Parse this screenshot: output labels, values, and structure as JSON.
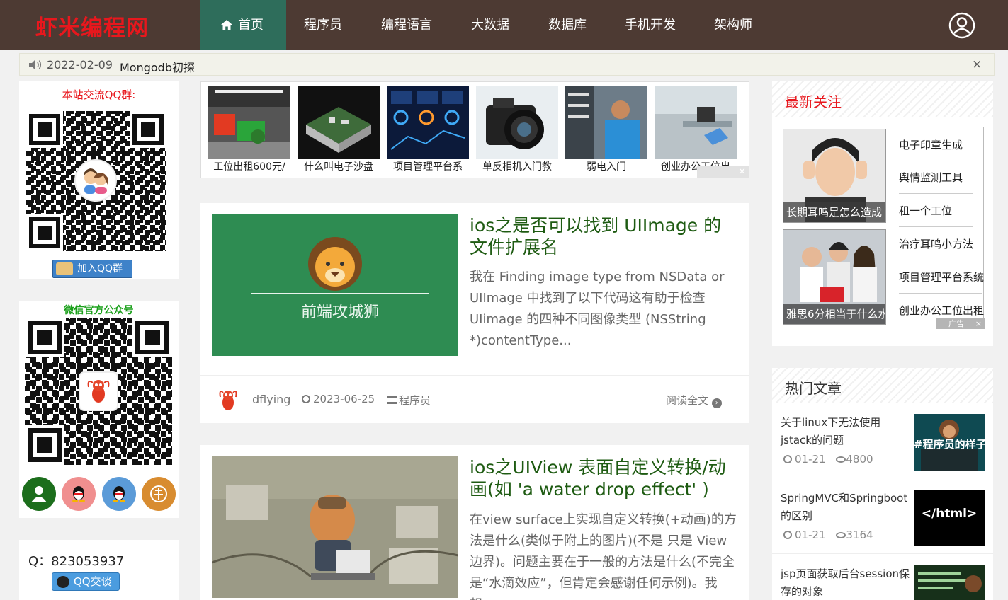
{
  "header": {
    "logo": "虾米编程网",
    "nav": [
      "首页",
      "程序员",
      "编程语言",
      "大数据",
      "数据库",
      "手机开发",
      "架构师"
    ],
    "active_nav": "首页",
    "user_icon": "user-circle-icon"
  },
  "notice": {
    "date": "2022-02-09",
    "title": "Mongodb初探",
    "close": "×"
  },
  "left": {
    "qq_group_title": "本站交流QQ群:",
    "join_qq_label": "加入QQ群",
    "wechat_title": "微信官方公众号",
    "qq_number": "Q：823053937",
    "qq_talk_label": "QQ交谈",
    "social_icons": [
      "user-icon",
      "qq-icon",
      "qq-icon",
      "weibo-icon"
    ],
    "colors": {
      "green": "#1c6e1c",
      "pink": "#f08f8f",
      "blue": "#5b9bd8",
      "orange": "#d88c30"
    }
  },
  "ads": {
    "items": [
      "工位出租600元/",
      "什么叫电子沙盘",
      "项目管理平台系",
      "单反相机入门教",
      "弱电入门",
      "创业办公工位出"
    ],
    "close": "×"
  },
  "articles": [
    {
      "title": "ios之是否可以找到 UIImage 的文件扩展名",
      "excerpt": "我在 Finding image type from NSData or UIImage 中找到了以下代码这有助于检查 UIimage 的四种不同图像类型 (NSString *)contentType...",
      "thumb_text": "前端攻城狮",
      "author": "dflying",
      "date": "2023-06-25",
      "category": "程序员",
      "read_more": "阅读全文"
    },
    {
      "title": "ios之UIView 表面自定义转换/动画(如 'a water drop effect' )",
      "excerpt": "在view surface上实现自定义转换(+动画)的方法是什么(类似于附上的图片)(不是 只是 View 边界)。问题主要在于一般的方法是什么(不完全是“水滴效应”，但肯定会感谢任何示例)。我想，"
    }
  ],
  "latest": {
    "heading": "最新关注",
    "pics": [
      "长期耳鸣是怎么造成",
      "雅思6分相当于什么水"
    ],
    "links": [
      "电子印章生成",
      "舆情监测工具",
      "租一个工位",
      "治疗耳鸣小方法",
      "项目管理平台系统",
      "创业办公工位出租"
    ],
    "ad_label": "广告",
    "close": "×"
  },
  "hot": {
    "heading": "热门文章",
    "items": [
      {
        "title": "关于linux下无法使用jstack的问题",
        "date": "01-21",
        "views": "4800",
        "thumb_text": "#程序员的样子#"
      },
      {
        "title": "SpringMVC和Springboot的区别",
        "date": "01-21",
        "views": "3164",
        "thumb_text": "</html>"
      },
      {
        "title": "jsp页面获取后台session保存的对象",
        "date": "",
        "views": "",
        "thumb_text": ""
      }
    ]
  }
}
